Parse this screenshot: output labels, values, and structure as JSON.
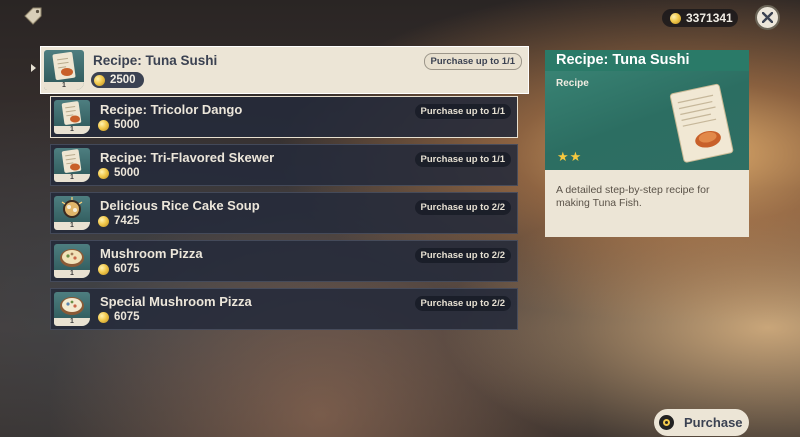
{
  "header": {
    "currency_amount": "3371341"
  },
  "items": [
    {
      "name": "Recipe: Tuna Sushi",
      "price": "2500",
      "limit": "Purchase up to 1/1",
      "qty": "1",
      "icon": "recipe-scroll-icon"
    },
    {
      "name": "Recipe: Tricolor Dango",
      "price": "5000",
      "limit": "Purchase up to 1/1",
      "qty": "1",
      "icon": "recipe-scroll-icon"
    },
    {
      "name": "Recipe: Tri-Flavored Skewer",
      "price": "5000",
      "limit": "Purchase up to 1/1",
      "qty": "1",
      "icon": "recipe-scroll-icon"
    },
    {
      "name": "Delicious Rice Cake Soup",
      "price": "7425",
      "limit": "Purchase up to 2/2",
      "qty": "1",
      "icon": "soup-bowl-icon"
    },
    {
      "name": "Mushroom Pizza",
      "price": "6075",
      "limit": "Purchase up to 2/2",
      "qty": "1",
      "icon": "pizza-icon"
    },
    {
      "name": "Special Mushroom Pizza",
      "price": "6075",
      "limit": "Purchase up to 2/2",
      "qty": "1",
      "icon": "pizza-icon"
    }
  ],
  "detail": {
    "title": "Recipe: Tuna Sushi",
    "type": "Recipe",
    "stars": "★★",
    "description": "A detailed step-by-step recipe for making Tuna Fish."
  },
  "purchase_button": {
    "label": "Purchase"
  },
  "colors": {
    "accent_green": "#2a7a68",
    "panel": "#ece5d6",
    "row_bg": "#242a3a",
    "gold": "#f2c94c"
  }
}
